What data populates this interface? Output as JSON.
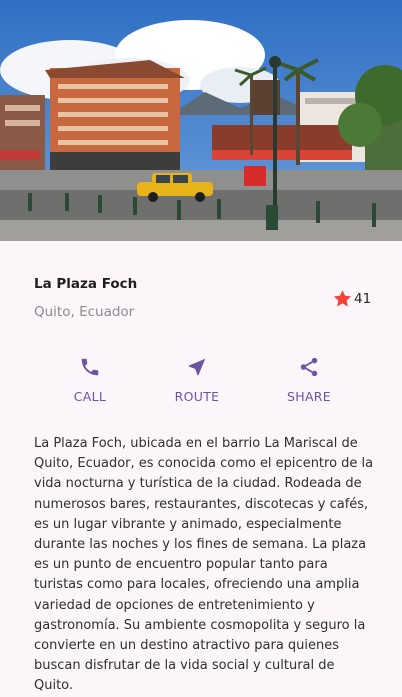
{
  "hero": {
    "image_alt": "Street view of La Plaza Foch with buildings, palm trees, and a yellow taxi"
  },
  "place": {
    "name": "La Plaza Foch",
    "location": "Quito, Ecuador",
    "rating_icon": "star-icon",
    "rating_count": "41",
    "star_color": "#f44336"
  },
  "actions": [
    {
      "label": "CALL",
      "icon": "phone-icon"
    },
    {
      "label": "ROUTE",
      "icon": "navigation-icon"
    },
    {
      "label": "SHARE",
      "icon": "share-icon"
    }
  ],
  "accent_color": "#6c54a4",
  "description": "La Plaza Foch, ubicada en el barrio La Mariscal de Quito, Ecuador, es conocida como el epicentro de la vida nocturna y turística de la ciudad. Rodeada de numerosos bares, restaurantes, discotecas y cafés, es un lugar vibrante y animado, especialmente durante las noches y los fines de semana. La plaza es un punto de encuentro popular tanto para turistas como para locales, ofreciendo una amplia variedad de opciones de entretenimiento y gastronomía. Su ambiente cosmopolita y seguro la convierte en un destino atractivo para quienes buscan disfrutar de la vida social y cultural de Quito."
}
